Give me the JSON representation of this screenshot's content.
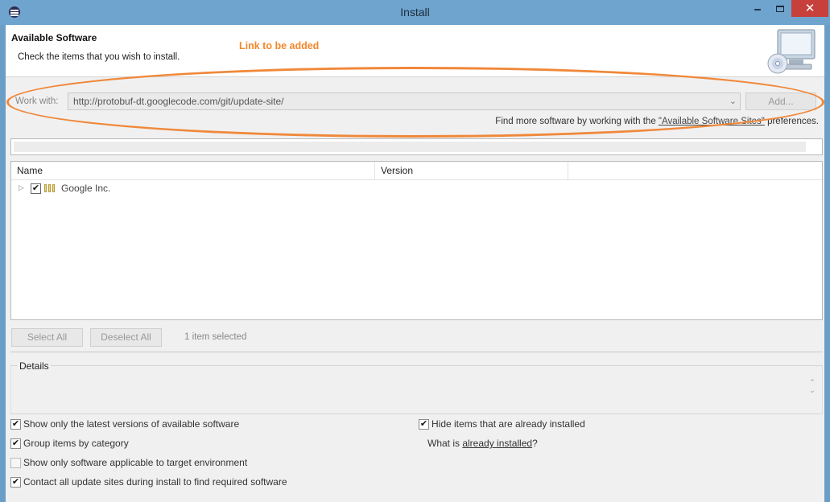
{
  "window": {
    "title": "Install",
    "minimize_glyph": "🗕",
    "close_glyph": "✕"
  },
  "header": {
    "title": "Available Software",
    "subtitle": "Check the items that you wish to install.",
    "annotation": "Link to be added",
    "icon": "monitor-cd-icon"
  },
  "work_with": {
    "label": "Work with:",
    "value": "http://protobuf-dt.googlecode.com/git/update-site/",
    "add_label": "Add...",
    "find_more_prefix": "Find more software by working with the ",
    "find_more_link": "\"Available Software Sites\"",
    "find_more_suffix": " preferences."
  },
  "filter": {
    "value": ""
  },
  "tree": {
    "columns": [
      "Name",
      "Version"
    ],
    "items": [
      {
        "label": "Google Inc.",
        "checked": true,
        "version": ""
      }
    ]
  },
  "selection": {
    "select_all": "Select All",
    "deselect_all": "Deselect All",
    "count_text": "1 item selected"
  },
  "details": {
    "label": "Details"
  },
  "options": {
    "latest_versions": {
      "label": "Show only the latest versions of available software",
      "checked": true
    },
    "group_by_category": {
      "label": "Group items by category",
      "checked": true
    },
    "target_env": {
      "label": "Show only software applicable to target environment",
      "checked": false
    },
    "contact_sites": {
      "label": "Contact all update sites during install to find required software",
      "checked": true
    },
    "hide_installed": {
      "label": "Hide items that are already installed",
      "checked": true
    },
    "what_is_prefix": "What is ",
    "what_is_link": "already installed",
    "what_is_suffix": "?"
  },
  "colors": {
    "titlebar": "#6fa4cf",
    "close_button": "#c7403b",
    "annotation": "#f2882c",
    "highlight_oval": "#f0883a"
  }
}
